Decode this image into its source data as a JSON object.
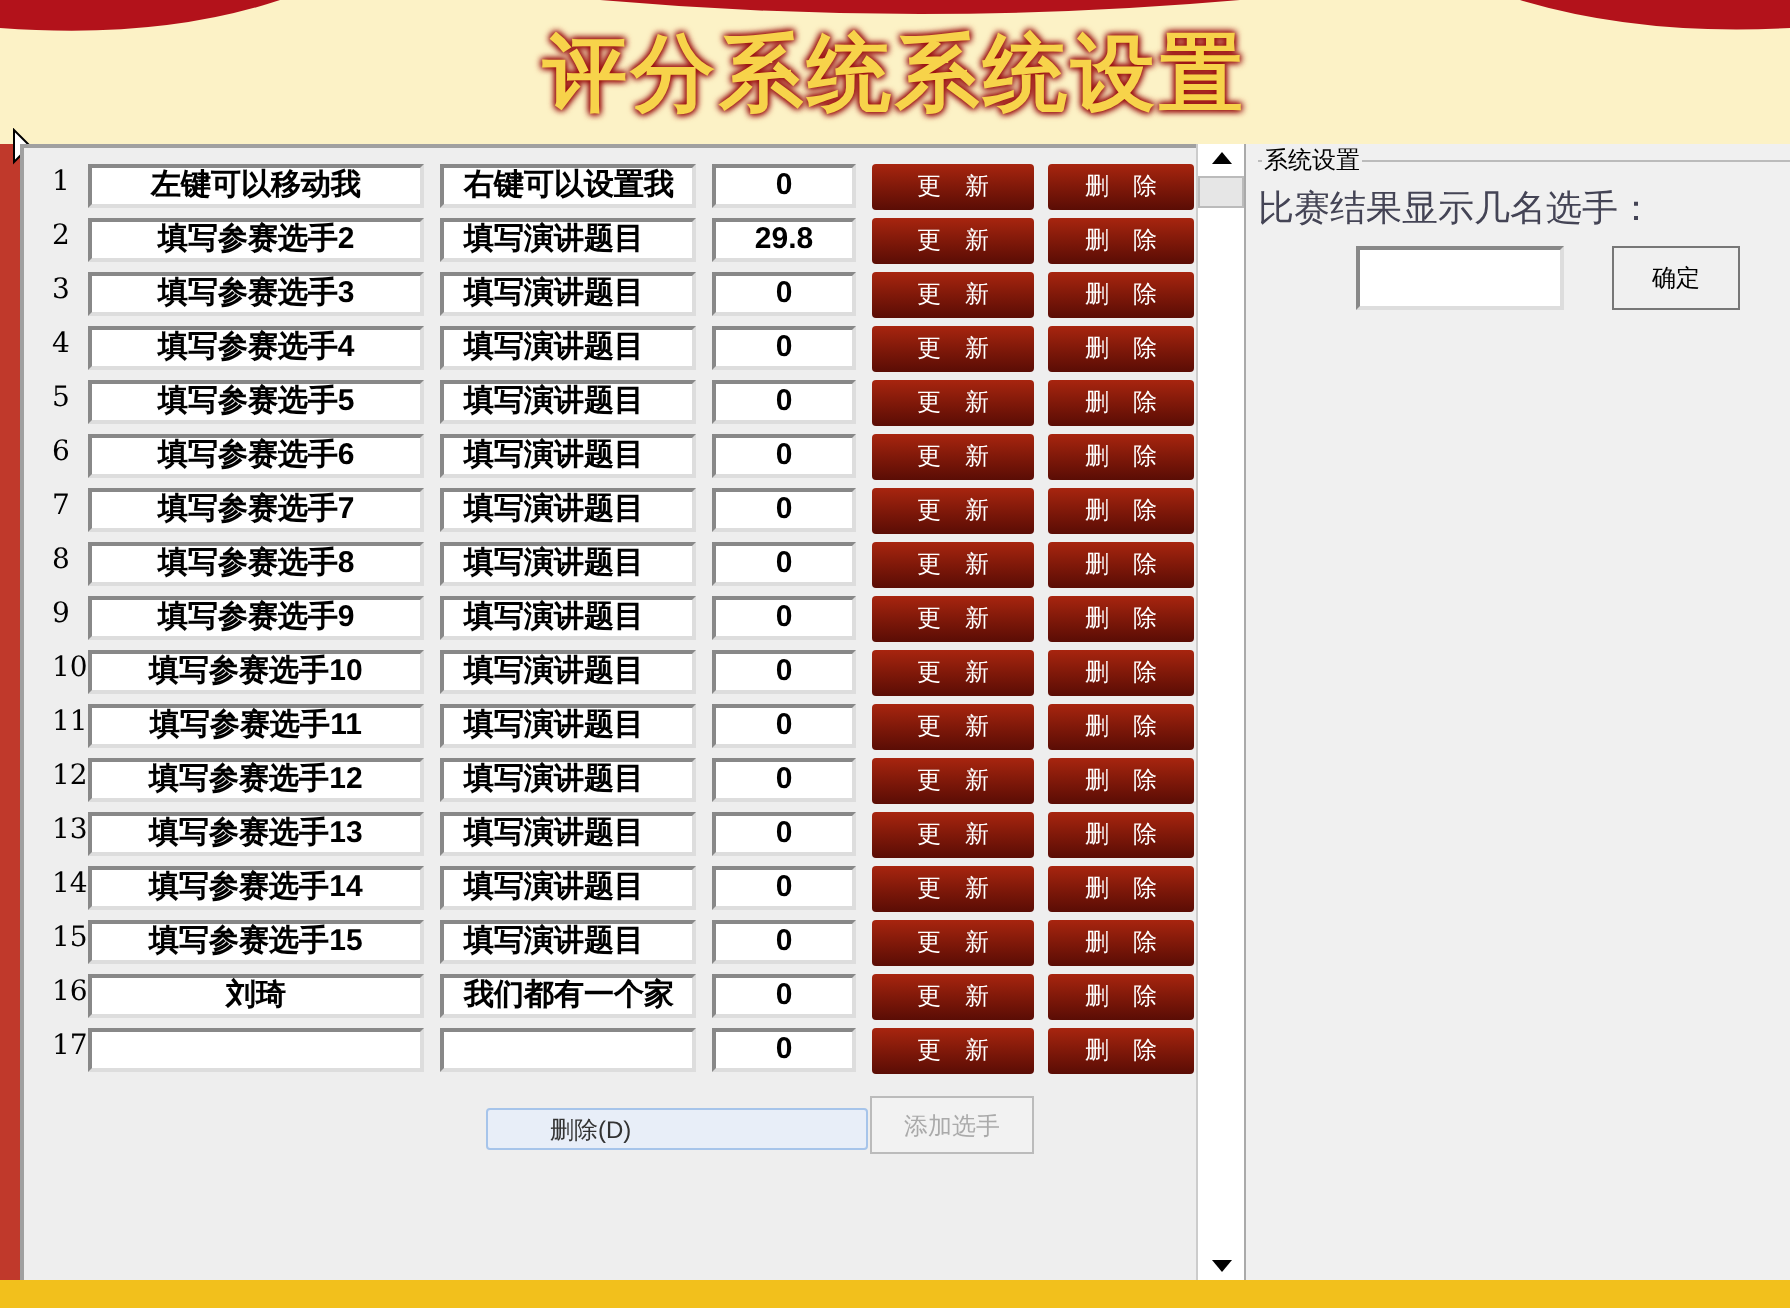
{
  "title": "评分系统系统设置",
  "rows": [
    {
      "number": "1",
      "name": "左键可以移动我",
      "topic": "右键可以设置我",
      "score": "0",
      "update": "更　新",
      "delete": "删　除"
    },
    {
      "number": "2",
      "name": "填写参赛选手2",
      "topic": "填写演讲题目",
      "score": "29.8",
      "update": "更　新",
      "delete": "删　除"
    },
    {
      "number": "3",
      "name": "填写参赛选手3",
      "topic": "填写演讲题目",
      "score": "0",
      "update": "更　新",
      "delete": "删　除"
    },
    {
      "number": "4",
      "name": "填写参赛选手4",
      "topic": "填写演讲题目",
      "score": "0",
      "update": "更　新",
      "delete": "删　除"
    },
    {
      "number": "5",
      "name": "填写参赛选手5",
      "topic": "填写演讲题目",
      "score": "0",
      "update": "更　新",
      "delete": "删　除"
    },
    {
      "number": "6",
      "name": "填写参赛选手6",
      "topic": "填写演讲题目",
      "score": "0",
      "update": "更　新",
      "delete": "删　除"
    },
    {
      "number": "7",
      "name": "填写参赛选手7",
      "topic": "填写演讲题目",
      "score": "0",
      "update": "更　新",
      "delete": "删　除"
    },
    {
      "number": "8",
      "name": "填写参赛选手8",
      "topic": "填写演讲题目",
      "score": "0",
      "update": "更　新",
      "delete": "删　除"
    },
    {
      "number": "9",
      "name": "填写参赛选手9",
      "topic": "填写演讲题目",
      "score": "0",
      "update": "更　新",
      "delete": "删　除"
    },
    {
      "number": "10",
      "name": "填写参赛选手10",
      "topic": "填写演讲题目",
      "score": "0",
      "update": "更　新",
      "delete": "删　除"
    },
    {
      "number": "11",
      "name": "填写参赛选手11",
      "topic": "填写演讲题目",
      "score": "0",
      "update": "更　新",
      "delete": "删　除"
    },
    {
      "number": "12",
      "name": "填写参赛选手12",
      "topic": "填写演讲题目",
      "score": "0",
      "update": "更　新",
      "delete": "删　除"
    },
    {
      "number": "13",
      "name": "填写参赛选手13",
      "topic": "填写演讲题目",
      "score": "0",
      "update": "更　新",
      "delete": "删　除"
    },
    {
      "number": "14",
      "name": "填写参赛选手14",
      "topic": "填写演讲题目",
      "score": "0",
      "update": "更　新",
      "delete": "删　除"
    },
    {
      "number": "15",
      "name": "填写参赛选手15",
      "topic": "填写演讲题目",
      "score": "0",
      "update": "更　新",
      "delete": "删　除"
    },
    {
      "number": "16",
      "name": "刘琦",
      "topic": "我们都有一个家",
      "score": "0",
      "update": "更　新",
      "delete": "删　除"
    },
    {
      "number": "17",
      "score": "0",
      "update": "更　新",
      "delete": "删　除"
    }
  ],
  "delete_bar": {
    "label": "删除(D)"
  },
  "add_button": {
    "label": "添加选手",
    "disabled": true
  },
  "settings": {
    "group_title": "系统设置",
    "prompt": "比赛结果显示几名选手：",
    "button": "确定"
  }
}
